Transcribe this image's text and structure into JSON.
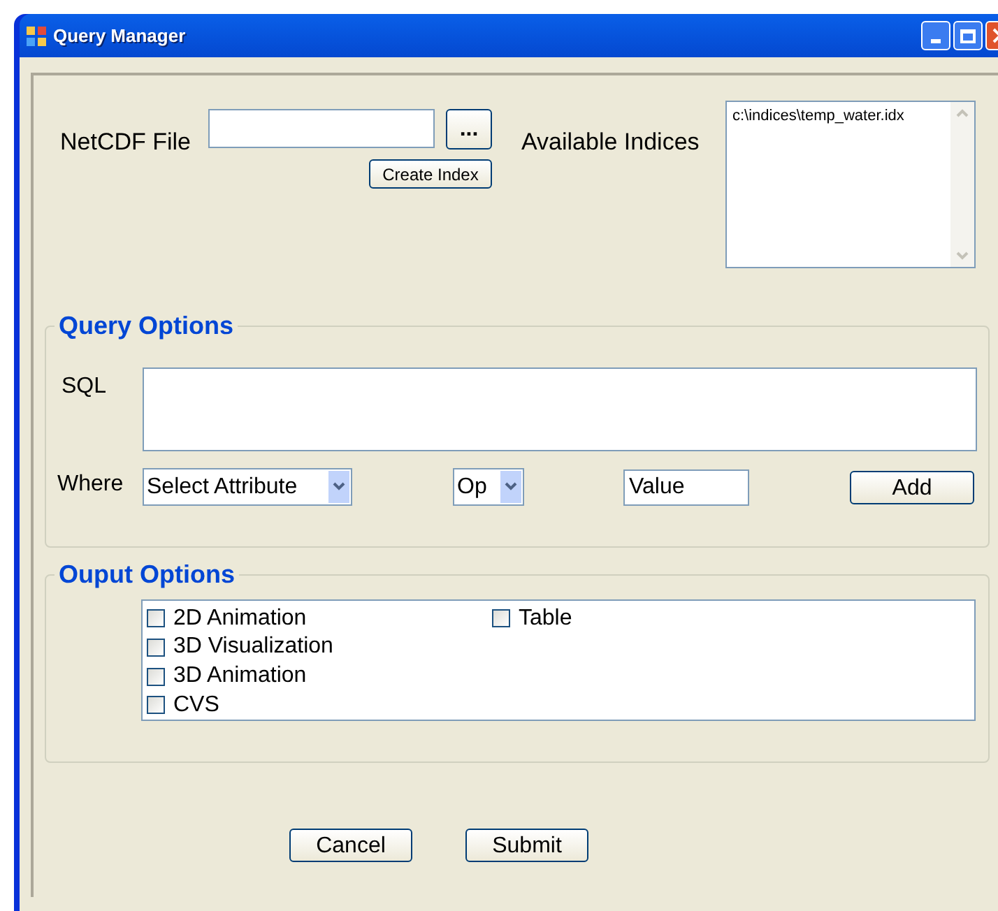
{
  "window": {
    "title": "Query Manager"
  },
  "file": {
    "label": "NetCDF File",
    "browse_button": "...",
    "create_button": "Create Index"
  },
  "indices": {
    "label": "Available Indices",
    "items": [
      {
        "text": "c:\\indices\\temp_water.idx",
        "selected": false
      }
    ]
  },
  "query_options": {
    "title": "Query Options",
    "sql_label": "SQL",
    "where_label": "Where",
    "attribute": "Select Attribute",
    "op": "Op",
    "value": "Value",
    "add_button": "Add"
  },
  "output_options": {
    "title": "Ouput Options",
    "items": [
      {
        "label": "2D Animation",
        "checked": false
      },
      {
        "label": "3D Visualization",
        "checked": false
      },
      {
        "label": "3D Animation",
        "checked": false
      },
      {
        "label": "CVS",
        "checked": false
      },
      {
        "label": "Table",
        "checked": false
      }
    ]
  },
  "buttons": [
    {
      "label": "Cancel"
    },
    {
      "label": "Submit"
    }
  ]
}
